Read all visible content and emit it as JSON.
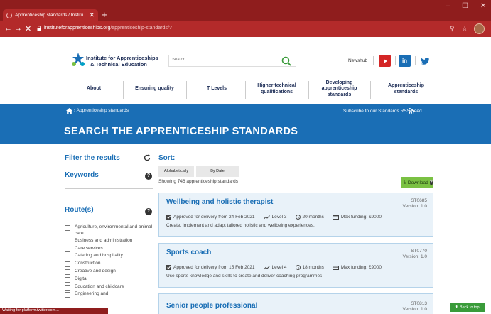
{
  "browser": {
    "tab_title": "Apprenticeship standards / Institu",
    "url_host": "instituteforapprenticeships.org",
    "url_path": "/apprenticeship-standards/?",
    "status_text": "Waiting for platform.twitter.com..."
  },
  "header": {
    "logo_line1": "Institute for Apprenticeships",
    "logo_line2": "& Technical Education",
    "search_placeholder": "Search...",
    "newshub": "Newshub"
  },
  "nav": {
    "items": [
      {
        "label": "About"
      },
      {
        "label": "Ensuring quality"
      },
      {
        "label": "T Levels"
      },
      {
        "label": "Higher technical qualifications"
      },
      {
        "label": "Developing apprenticeship standards"
      },
      {
        "label": "Apprenticeship standards"
      }
    ]
  },
  "hero": {
    "breadcrumb": "Apprenticeship standards",
    "rss": "Subscribe to our Standards RSS Feed",
    "title": "SEARCH THE APPRENTICESHIP STANDARDS"
  },
  "filters": {
    "title": "Filter the results",
    "keywords_title": "Keywords",
    "route_title": "Route(s)",
    "routes": [
      "Agriculture, environmental and animal care",
      "Business and administration",
      "Care services",
      "Catering and hospitality",
      "Construction",
      "Creative and design",
      "Digital",
      "Education and childcare",
      "Engineering and"
    ]
  },
  "sort": {
    "title": "Sort:",
    "alphabetically": "Alphabetically",
    "by_date": "By Date",
    "count_text": "Showing 746 apprenticeship standards",
    "download": "Download"
  },
  "cards": [
    {
      "title": "Wellbeing and holistic therapist",
      "code": "ST0685",
      "version": "Version: 1.0",
      "approved": "Approved for delivery from 24 Feb 2021",
      "level": "Level 3",
      "duration": "20 months",
      "funding": "Max funding: £9000",
      "description": "Create, implement and adapt tailored holistic and wellbeing experiences."
    },
    {
      "title": "Sports coach",
      "code": "ST0770",
      "version": "Version: 1.0",
      "approved": "Approved for delivery from 15 Feb 2021",
      "level": "Level 4",
      "duration": "18 months",
      "funding": "Max funding: £9000",
      "description": "Use sports knowledge and skills to create and deliver coaching programmes"
    },
    {
      "title": "Senior people professional",
      "code": "ST0813",
      "version": "Version: 1.0"
    }
  ],
  "back_to_top": "Back to top",
  "colors": {
    "brand_blue": "#1a6eb5",
    "navy": "#1c2c55",
    "download_green": "#7ac143",
    "browser_red": "#b32a2a"
  }
}
